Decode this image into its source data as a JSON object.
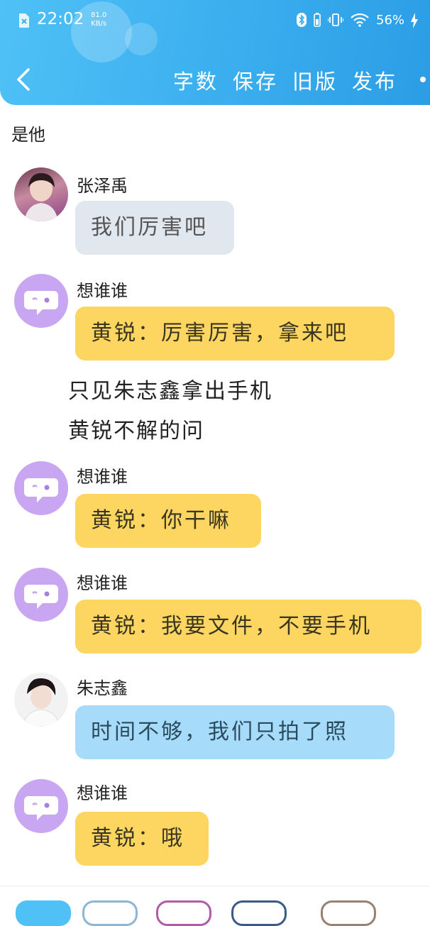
{
  "status_bar": {
    "time": "22:02",
    "speed_value": "81.0",
    "speed_unit": "KB/s",
    "battery": "56%"
  },
  "header": {
    "back_icon": "chevron-left-icon",
    "menu": [
      "字数",
      "保存",
      "旧版",
      "发布"
    ]
  },
  "intro_text": "是他",
  "messages": [
    {
      "name": "张泽禹",
      "text": "我们厉害吧",
      "style": "gray",
      "avatar": "photo"
    },
    {
      "name": "想谁谁",
      "text": "黄锐：厉害厉害，拿来吧",
      "style": "yellow",
      "avatar": "default"
    },
    {
      "name": "想谁谁",
      "text": "黄锐：你干嘛",
      "style": "yellow",
      "avatar": "default"
    },
    {
      "name": "想谁谁",
      "text": "黄锐：我要文件，不要手机",
      "style": "yellow",
      "avatar": "default"
    },
    {
      "name": "朱志鑫",
      "text": "时间不够，我们只拍了照",
      "style": "blue",
      "avatar": "photo"
    },
    {
      "name": "想谁谁",
      "text": "黄锐：哦",
      "style": "yellow",
      "avatar": "default"
    }
  ],
  "narration": [
    "只见朱志鑫拿出手机",
    "黄锐不解的问"
  ],
  "colors": {
    "header": "#3aaeee",
    "yellow_bubble": "#fcd660",
    "gray_bubble": "#e1e7ee",
    "blue_bubble": "#a6dcfa",
    "default_avatar": "#c9a6f2"
  }
}
